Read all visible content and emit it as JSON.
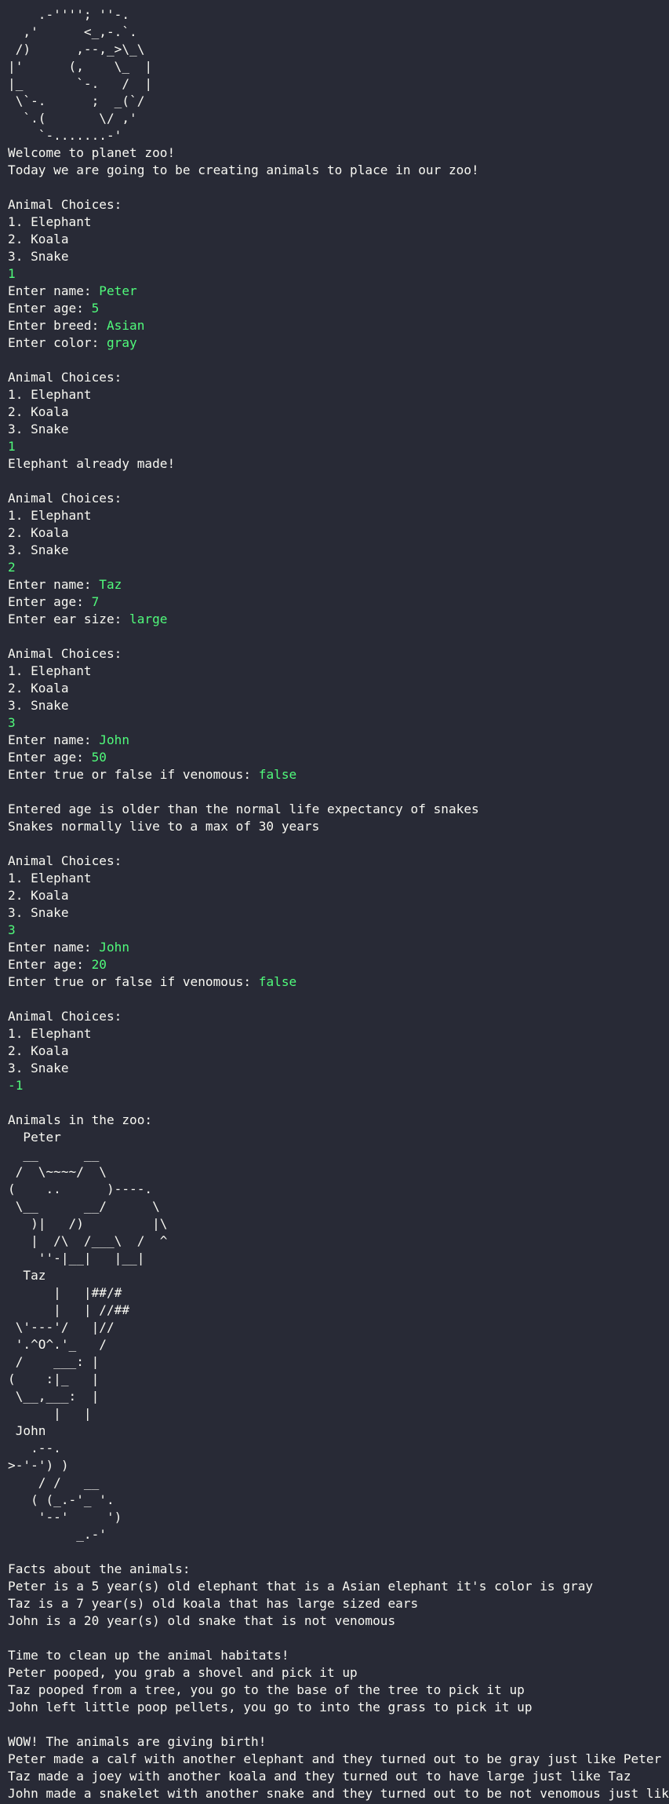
{
  "colors": {
    "background": "#282a36",
    "text": "#f8f8f2",
    "user_input": "#50fa7b"
  },
  "lines": [
    {
      "text": "    .-''''; ''-."
    },
    {
      "text": "  ,'      <_,-.`."
    },
    {
      "text": " /)      ,--,_>\\_\\"
    },
    {
      "text": "|'      (,    \\_  |"
    },
    {
      "text": "|_       `-.   /  |"
    },
    {
      "text": " \\`-.      ;  _(`/"
    },
    {
      "text": "  `.(       \\/ ,'"
    },
    {
      "text": "    `-.......-'"
    },
    {
      "text": "Welcome to planet zoo!"
    },
    {
      "text": "Today we are going to be creating animals to place in our zoo!"
    },
    {
      "text": ""
    },
    {
      "text": "Animal Choices:"
    },
    {
      "text": "1. Elephant"
    },
    {
      "text": "2. Koala"
    },
    {
      "text": "3. Snake"
    },
    {
      "text": "",
      "input": "1"
    },
    {
      "text": "Enter name: ",
      "input": "Peter"
    },
    {
      "text": "Enter age: ",
      "input": "5"
    },
    {
      "text": "Enter breed: ",
      "input": "Asian"
    },
    {
      "text": "Enter color: ",
      "input": "gray"
    },
    {
      "text": ""
    },
    {
      "text": "Animal Choices:"
    },
    {
      "text": "1. Elephant"
    },
    {
      "text": "2. Koala"
    },
    {
      "text": "3. Snake"
    },
    {
      "text": "",
      "input": "1"
    },
    {
      "text": "Elephant already made!"
    },
    {
      "text": ""
    },
    {
      "text": "Animal Choices:"
    },
    {
      "text": "1. Elephant"
    },
    {
      "text": "2. Koala"
    },
    {
      "text": "3. Snake"
    },
    {
      "text": "",
      "input": "2"
    },
    {
      "text": "Enter name: ",
      "input": "Taz"
    },
    {
      "text": "Enter age: ",
      "input": "7"
    },
    {
      "text": "Enter ear size: ",
      "input": "large"
    },
    {
      "text": ""
    },
    {
      "text": "Animal Choices:"
    },
    {
      "text": "1. Elephant"
    },
    {
      "text": "2. Koala"
    },
    {
      "text": "3. Snake"
    },
    {
      "text": "",
      "input": "3"
    },
    {
      "text": "Enter name: ",
      "input": "John"
    },
    {
      "text": "Enter age: ",
      "input": "50"
    },
    {
      "text": "Enter true or false if venomous: ",
      "input": "false"
    },
    {
      "text": ""
    },
    {
      "text": "Entered age is older than the normal life expectancy of snakes"
    },
    {
      "text": "Snakes normally live to a max of 30 years"
    },
    {
      "text": ""
    },
    {
      "text": "Animal Choices:"
    },
    {
      "text": "1. Elephant"
    },
    {
      "text": "2. Koala"
    },
    {
      "text": "3. Snake"
    },
    {
      "text": "",
      "input": "3"
    },
    {
      "text": "Enter name: ",
      "input": "John"
    },
    {
      "text": "Enter age: ",
      "input": "20"
    },
    {
      "text": "Enter true or false if venomous: ",
      "input": "false"
    },
    {
      "text": ""
    },
    {
      "text": "Animal Choices:"
    },
    {
      "text": "1. Elephant"
    },
    {
      "text": "2. Koala"
    },
    {
      "text": "3. Snake"
    },
    {
      "text": "",
      "input": "-1"
    },
    {
      "text": ""
    },
    {
      "text": "Animals in the zoo:"
    },
    {
      "text": "  Peter"
    },
    {
      "text": "  __      __"
    },
    {
      "text": " /  \\~~~~/  \\"
    },
    {
      "text": "(    ..      )----."
    },
    {
      "text": " \\__      __/      \\"
    },
    {
      "text": "   )|   /)         |\\"
    },
    {
      "text": "   |  /\\  /___\\  /  ^"
    },
    {
      "text": "    ''-|__|   |__|"
    },
    {
      "text": "  Taz"
    },
    {
      "text": "      |   |##/#"
    },
    {
      "text": "      |   | //##"
    },
    {
      "text": " \\'---'/   |//"
    },
    {
      "text": " '.^O^.'_   /"
    },
    {
      "text": " /    ___: |"
    },
    {
      "text": "(    :|_   |"
    },
    {
      "text": " \\__,___:  |"
    },
    {
      "text": "      |   |"
    },
    {
      "text": " John"
    },
    {
      "text": "   .--."
    },
    {
      "text": ">-'-') )"
    },
    {
      "text": "    / /   __"
    },
    {
      "text": "   ( (_.-'_ '."
    },
    {
      "text": "    '--'     ')"
    },
    {
      "text": "         _.-'"
    },
    {
      "text": ""
    },
    {
      "text": "Facts about the animals:"
    },
    {
      "text": "Peter is a 5 year(s) old elephant that is a Asian elephant it's color is gray"
    },
    {
      "text": "Taz is a 7 year(s) old koala that has large sized ears"
    },
    {
      "text": "John is a 20 year(s) old snake that is not venomous"
    },
    {
      "text": ""
    },
    {
      "text": "Time to clean up the animal habitats!"
    },
    {
      "text": "Peter pooped, you grab a shovel and pick it up"
    },
    {
      "text": "Taz pooped from a tree, you go to the base of the tree to pick it up"
    },
    {
      "text": "John left little poop pellets, you go to into the grass to pick it up"
    },
    {
      "text": ""
    },
    {
      "text": "WOW! The animals are giving birth!"
    },
    {
      "text": "Peter made a calf with another elephant and they turned out to be gray just like Peter"
    },
    {
      "text": "Taz made a joey with another koala and they turned out to have large just like Taz"
    },
    {
      "text": "John made a snakelet with another snake and they turned out to be not venomous just like John"
    }
  ]
}
